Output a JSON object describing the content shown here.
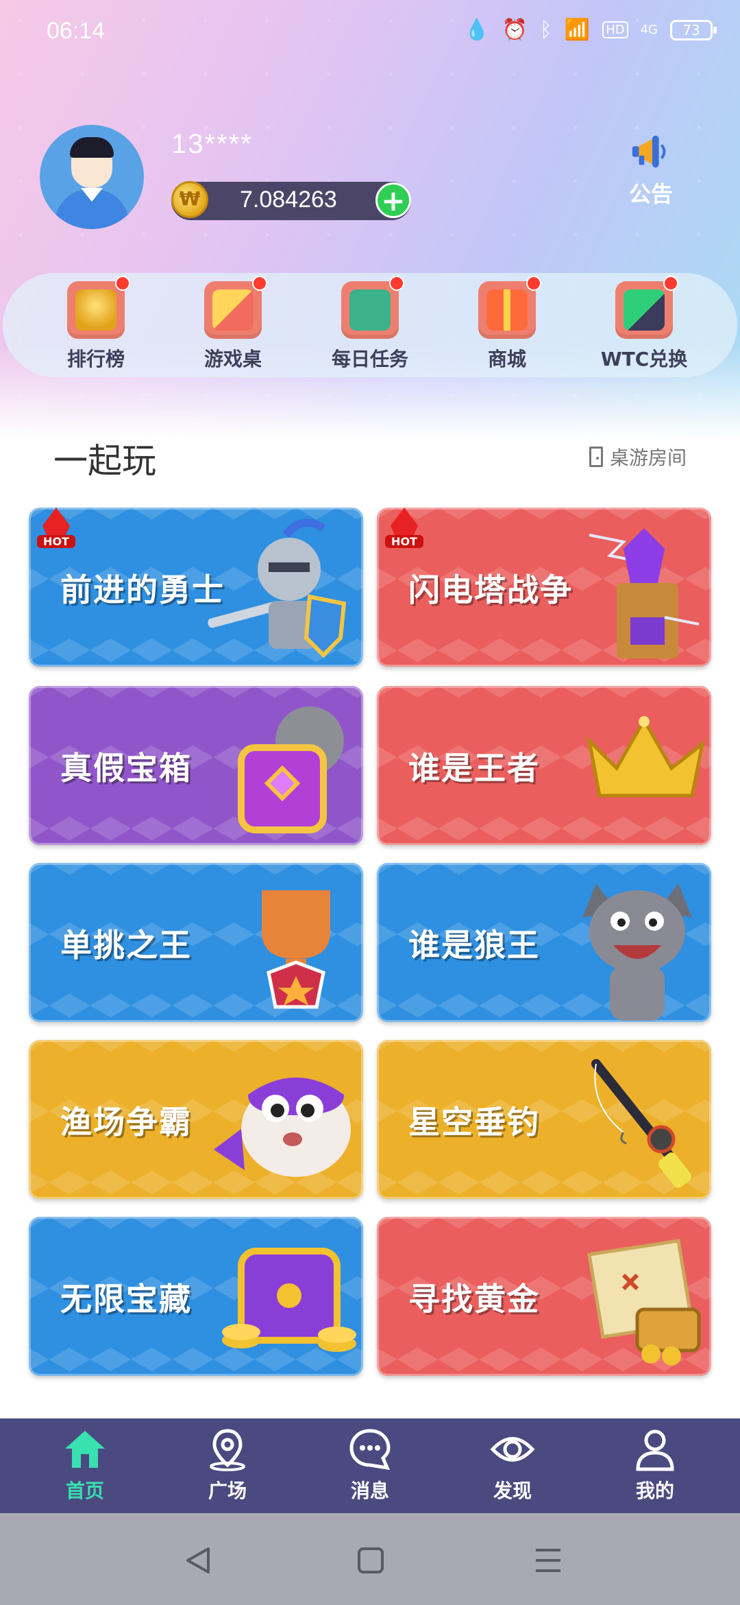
{
  "status_bar": {
    "time": "06:14",
    "battery": "73",
    "network": "4G",
    "hd": "HD"
  },
  "profile": {
    "username": "13****",
    "balance": "7.084263",
    "add_symbol": "+"
  },
  "notice": {
    "label": "公告"
  },
  "features": [
    {
      "label": "排行榜",
      "icon": "trophy-icon"
    },
    {
      "label": "游戏桌",
      "icon": "game-table-icon"
    },
    {
      "label": "每日任务",
      "icon": "daily-task-icon"
    },
    {
      "label": "商城",
      "icon": "gift-box-icon"
    },
    {
      "label": "WTC兑换",
      "icon": "exchange-icon"
    }
  ],
  "section": {
    "title": "一起玩",
    "room_link": "桌游房间"
  },
  "games": [
    {
      "title": "前进的勇士",
      "hot": "HOT",
      "color": "#2f8fe0"
    },
    {
      "title": "闪电塔战争",
      "hot": "HOT",
      "color": "#ea5e5d"
    },
    {
      "title": "真假宝箱",
      "color": "#9056c9"
    },
    {
      "title": "谁是王者",
      "color": "#ea5e5d"
    },
    {
      "title": "单挑之王",
      "color": "#2f8fe0"
    },
    {
      "title": "谁是狼王",
      "color": "#2f8fe0"
    },
    {
      "title": "渔场争霸",
      "color": "#ecb02a"
    },
    {
      "title": "星空垂钓",
      "color": "#ecb02a"
    },
    {
      "title": "无限宝藏",
      "color": "#2f8fe0"
    },
    {
      "title": "寻找黄金",
      "color": "#ea5e5d"
    }
  ],
  "bottom_nav": [
    {
      "label": "首页",
      "icon": "home-icon",
      "active": true
    },
    {
      "label": "广场",
      "icon": "location-pin-icon"
    },
    {
      "label": "消息",
      "icon": "chat-bubble-icon"
    },
    {
      "label": "发现",
      "icon": "eye-icon"
    },
    {
      "label": "我的",
      "icon": "person-icon"
    }
  ],
  "colors": {
    "accent": "#39e0b0",
    "nav_bg": "#4a4a80",
    "badge_red": "#ff3b30"
  }
}
